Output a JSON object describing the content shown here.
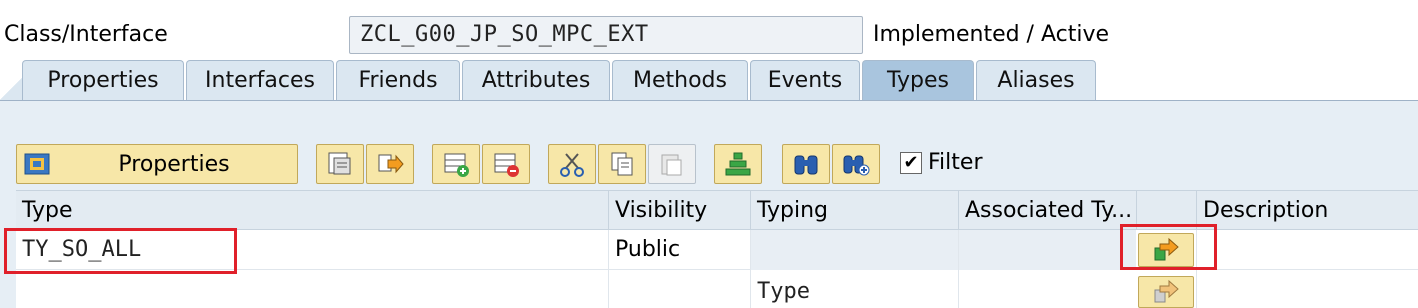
{
  "header": {
    "label": "Class/Interface",
    "class_name": "ZCL_G00_JP_SO_MPC_EXT",
    "status": "Implemented / Active"
  },
  "tabs": [
    {
      "label": "Properties",
      "active": false
    },
    {
      "label": "Interfaces",
      "active": false
    },
    {
      "label": "Friends",
      "active": false
    },
    {
      "label": "Attributes",
      "active": false
    },
    {
      "label": "Methods",
      "active": false
    },
    {
      "label": "Events",
      "active": false
    },
    {
      "label": "Types",
      "active": true
    },
    {
      "label": "Aliases",
      "active": false
    }
  ],
  "toolbar": {
    "properties_label": "Properties",
    "filter_label": "Filter",
    "filter_checked": true,
    "icons": [
      "properties-icon",
      "detail-view-icon",
      "goto-icon",
      "insert-row-icon",
      "delete-row-icon",
      "cut-icon",
      "copy-icon",
      "paste-icon",
      "hierarchy-icon",
      "find-icon",
      "find-next-icon"
    ]
  },
  "table": {
    "columns": [
      "Type",
      "Visibility",
      "Typing",
      "Associated Ty...",
      "",
      "Description"
    ],
    "rows": [
      {
        "type": "TY_SO_ALL",
        "visibility": "Public",
        "typing": "",
        "associated": "",
        "description": ""
      },
      {
        "type": "",
        "visibility": "",
        "typing": "Type",
        "associated": "",
        "description": ""
      }
    ]
  },
  "colors": {
    "accent_button": "#f7e7a8",
    "tab_active": "#a9c5de",
    "highlight": "#e0202a"
  }
}
